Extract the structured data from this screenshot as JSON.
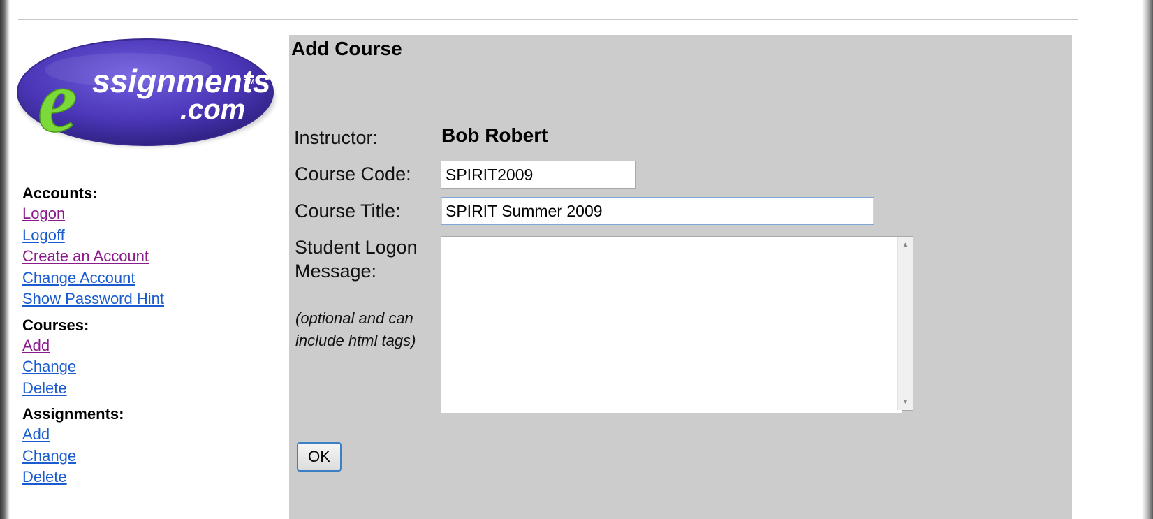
{
  "logo": {
    "brand_main": "ssignments",
    "brand_letter": "e",
    "tm": "TM",
    "domain": ".com"
  },
  "sidebar": {
    "groups": [
      {
        "heading": "Accounts:",
        "links": [
          "Logon",
          "Logoff",
          "Create an Account",
          "Change Account",
          "Show Password Hint"
        ]
      },
      {
        "heading": "Courses:",
        "links": [
          "Add",
          "Change",
          "Delete"
        ]
      },
      {
        "heading": "Assignments:",
        "links": [
          "Add",
          "Change",
          "Delete"
        ]
      }
    ],
    "link_colors": {
      "unvisited": "#1a5bd0",
      "visited": "#8b1a8b"
    }
  },
  "main": {
    "title": "Add Course",
    "background": "#cccccc",
    "form": {
      "instructor_label": "Instructor:",
      "instructor_name": "Bob Robert",
      "course_code_label": "Course Code:",
      "course_code_value": "SPIRIT2009",
      "course_title_label": "Course Title:",
      "course_title_value": "SPIRIT Summer 2009",
      "student_logon_label_line1": "Student Logon",
      "student_logon_label_line2": "Message:",
      "student_logon_message_value": "",
      "hint_line1": "(optional and can",
      "hint_line2": "include html tags)",
      "ok_label": "OK"
    }
  },
  "icons": {
    "scroll_up": "scroll-up-arrow-icon",
    "scroll_down": "scroll-down-arrow-icon"
  }
}
